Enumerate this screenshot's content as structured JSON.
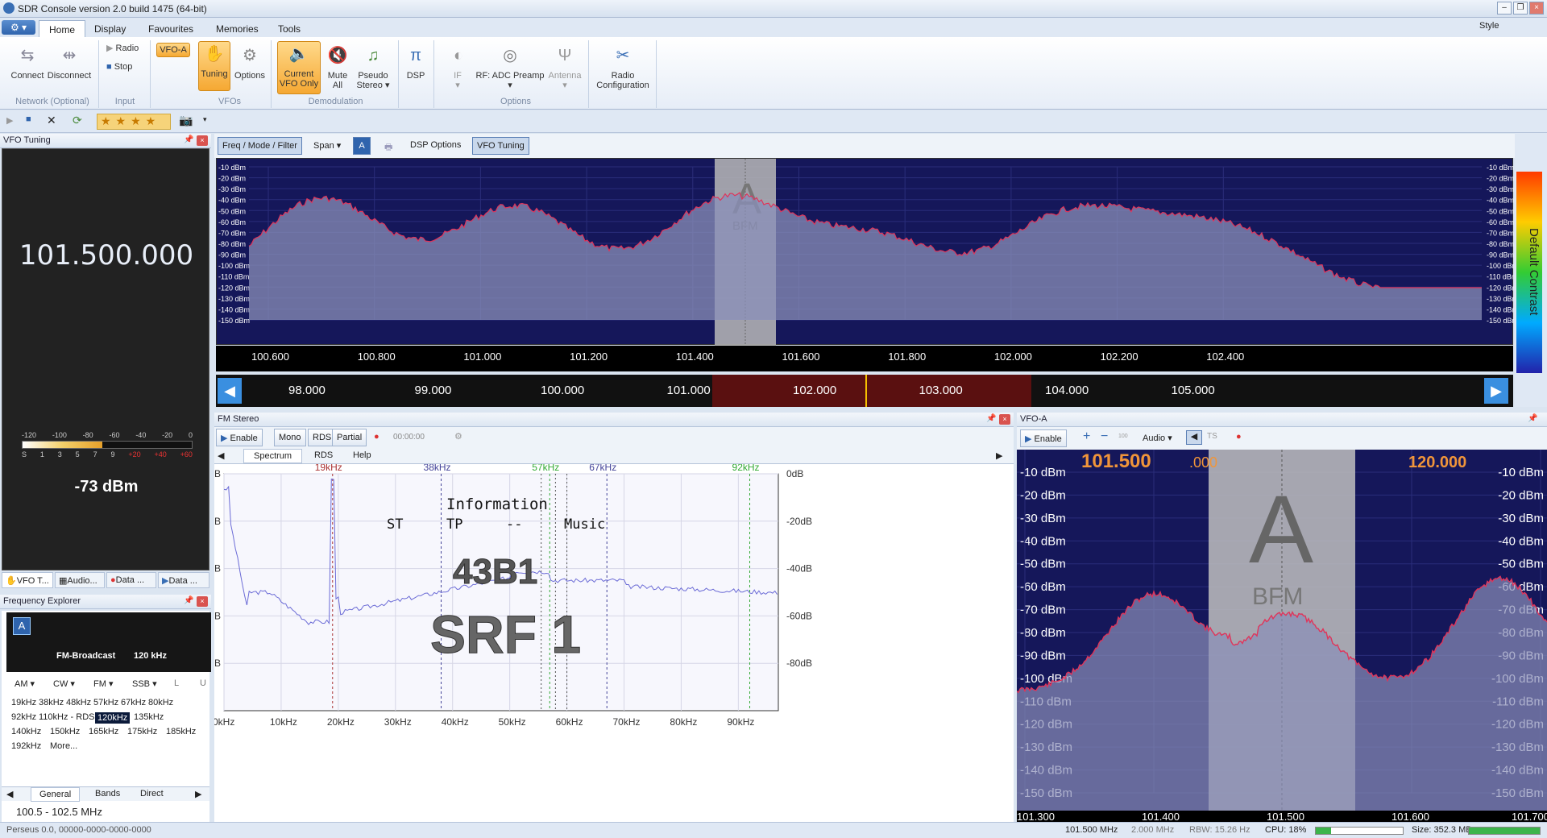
{
  "window": {
    "title": "SDR Console version 2.0 build 1475 (64-bit)",
    "style_label": "Style"
  },
  "tabs": [
    "Home",
    "Display",
    "Favourites",
    "Memories",
    "Tools"
  ],
  "ribbon": {
    "connect": "Connect",
    "disconnect": "Disconnect",
    "network_group": "Network (Optional)",
    "radio": "Radio",
    "stop": "Stop",
    "input_group": "Input",
    "vfo_a": "VFO-A",
    "tuning": "Tuning",
    "options": "Options",
    "vfos_group": "VFOs",
    "current_vfo": "Current",
    "current_vfo2": "VFO Only",
    "mute": "Mute",
    "mute2": "All",
    "pseudo": "Pseudo",
    "pseudo2": "Stereo",
    "demod_group": "Demodulation",
    "dsp": "DSP",
    "if": "IF",
    "rf": "RF: ADC Preamp",
    "antenna": "Antenna",
    "options_group": "Options",
    "radio_config": "Radio",
    "radio_config2": "Configuration"
  },
  "vfo_tuning": {
    "header": "VFO Tuning",
    "frequency": "101.500.000",
    "level": "-73 dBm",
    "meter_top": [
      "-120",
      "-100",
      "-80",
      "-60",
      "-40",
      "-20",
      "0"
    ],
    "meter_bottom": [
      "S",
      "1",
      "3",
      "5",
      "7",
      "9",
      "+20",
      "+40",
      "+60"
    ],
    "signal_fraction": 0.47
  },
  "left_tabs": [
    "VFO T...",
    "Audio...",
    "Data ...",
    "Data ..."
  ],
  "freq_explorer": {
    "header": "Frequency Explorer",
    "badge": "A",
    "band": "FM-Broadcast",
    "bw": "120 kHz",
    "modes": [
      "AM",
      "CW",
      "FM",
      "SSB",
      "L",
      "U"
    ],
    "rows": [
      [
        "19kHz",
        "38kHz",
        "48kHz",
        "57kHz",
        "67kHz",
        "80kHz"
      ],
      [
        "92kHz",
        "110kHz - RDS",
        "120kHz",
        "135kHz"
      ],
      [
        "140kHz",
        "150kHz",
        "165kHz",
        "175kHz",
        "185kHz"
      ],
      [
        "192kHz",
        "More..."
      ]
    ],
    "selected": "120kHz",
    "bottom_tabs": [
      "General",
      "Bands",
      "Direct"
    ],
    "range": "100.5 - 102.5 MHz"
  },
  "spectrum_toolbar": {
    "freq_mode": "Freq / Mode / Filter",
    "span": "Span",
    "a": "A",
    "dsp_options": "DSP Options",
    "vfo_tuning": "VFO Tuning"
  },
  "spectrum": {
    "db_labels": [
      "-10 dBm",
      "-20 dBm",
      "-30 dBm",
      "-40 dBm",
      "-50 dBm",
      "-60 dBm",
      "-70 dBm",
      "-80 dBm",
      "-90 dBm",
      "-100 dBm",
      "-110 dBm",
      "-120 dBm",
      "-130 dBm",
      "-140 dBm",
      "-150 dBm"
    ],
    "vfo_letter": "A",
    "mode": "BFM",
    "contrast_label": "Default Contrast",
    "scale1": [
      "100.600",
      "100.800",
      "101.000",
      "101.200",
      "101.400",
      "101.600",
      "101.800",
      "102.000",
      "102.200",
      "102.400"
    ],
    "scale2": [
      "98.000",
      "99.000",
      "100.000",
      "101.000",
      "102.000",
      "103.000",
      "104.000",
      "105.000"
    ]
  },
  "fm_stereo": {
    "header": "FM Stereo",
    "enable": "Enable",
    "mono": "Mono",
    "rds": "RDS",
    "partial": "Partial",
    "time": "00:00:00",
    "tabs": [
      "Spectrum",
      "RDS",
      "Help"
    ],
    "markers": [
      "19kHz",
      "38kHz",
      "57kHz",
      "67kHz",
      "92kHz"
    ],
    "y_labels": [
      "0dB",
      "-20dB",
      "-40dB",
      "-60dB",
      "-80dB"
    ],
    "x_labels": [
      "0kHz",
      "10kHz",
      "20kHz",
      "30kHz",
      "40kHz",
      "50kHz",
      "60kHz",
      "70kHz",
      "80kHz",
      "90kHz"
    ],
    "info": "Information",
    "flags": [
      "ST",
      "TP",
      "--",
      "Music"
    ],
    "pi": "43B1",
    "ps": "SRF 1"
  },
  "vfo_a_panel": {
    "header": "VFO-A",
    "enable": "Enable",
    "audio": "Audio",
    "freq": "101.500",
    "freq_small": ".000",
    "bw": "120.000",
    "letter": "A",
    "mode": "BFM",
    "db_labels": [
      "-10 dBm",
      "-20 dBm",
      "-30 dBm",
      "-40 dBm",
      "-50 dBm",
      "-60 dBm",
      "-70 dBm",
      "-80 dBm",
      "-90 dBm",
      "-100 dBm",
      "-110 dBm",
      "-120 dBm",
      "-130 dBm",
      "-140 dBm",
      "-150 dBm"
    ],
    "scale": [
      "101.300",
      "101.400",
      "101.500",
      "101.600",
      "101.700"
    ]
  },
  "status": {
    "device": "Perseus 0.0, 00000-0000-0000-0000",
    "freq": "101.500 MHz",
    "span": "2.000 MHz",
    "rbw": "RBW: 15.26 Hz",
    "cpu": "CPU: 18%",
    "size": "Size: 352.3 MB",
    "cpu_fraction": 0.18
  },
  "colors": {
    "accent": "#f5a833",
    "spec_bg": "#15175a",
    "trace": "#e0345a",
    "fill": "#8a8fb8"
  }
}
